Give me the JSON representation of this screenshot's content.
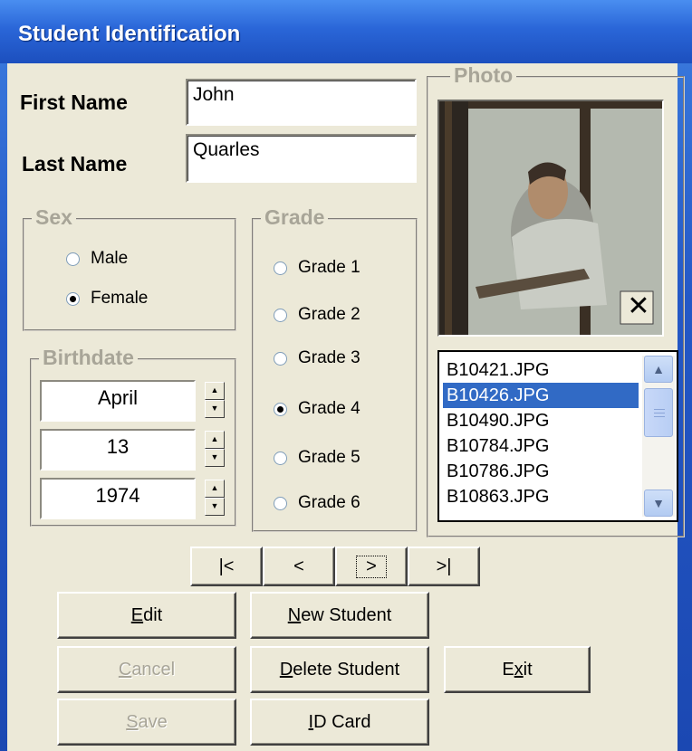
{
  "window": {
    "title": "Student Identification"
  },
  "form": {
    "first_name_label": "First Name",
    "first_name_value": "John",
    "last_name_label": "Last Name",
    "last_name_value": "Quarles"
  },
  "sex": {
    "title": "Sex",
    "options": [
      {
        "label": "Male",
        "checked": false
      },
      {
        "label": "Female",
        "checked": true
      }
    ]
  },
  "birthdate": {
    "title": "Birthdate",
    "month": "April",
    "day": "13",
    "year": "1974",
    "spin_up": "▲",
    "spin_down": "▼"
  },
  "grade": {
    "title": "Grade",
    "options": [
      {
        "label": "Grade 1",
        "checked": false
      },
      {
        "label": "Grade 2",
        "checked": false
      },
      {
        "label": "Grade 3",
        "checked": false
      },
      {
        "label": "Grade 4",
        "checked": true
      },
      {
        "label": "Grade 5",
        "checked": false
      },
      {
        "label": "Grade 6",
        "checked": false
      }
    ]
  },
  "photo": {
    "title": "Photo",
    "clear_icon": "✕",
    "files": [
      "B10421.JPG",
      "B10426.JPG",
      "B10490.JPG",
      "B10784.JPG",
      "B10786.JPG",
      "B10863.JPG"
    ],
    "selected_index": 1
  },
  "nav": {
    "first": "|<",
    "prev": "<",
    "next": ">",
    "last": ">|"
  },
  "buttons": {
    "edit": {
      "pre": "",
      "key": "E",
      "post": "dit"
    },
    "new_student": {
      "pre": "",
      "key": "N",
      "post": "ew Student"
    },
    "cancel": {
      "pre": "",
      "key": "C",
      "post": "ancel"
    },
    "delete_student": {
      "pre": "",
      "key": "D",
      "post": "elete Student"
    },
    "exit": {
      "pre": "E",
      "key": "x",
      "post": "it"
    },
    "save": {
      "pre": "",
      "key": "S",
      "post": "ave"
    },
    "id_card": {
      "pre": "",
      "key": "I",
      "post": "D Card"
    }
  },
  "colors": {
    "title_bar": "#2a66d8",
    "window_face": "#ece9d8",
    "selection": "#316ac5",
    "disabled_text": "#a8a598"
  }
}
